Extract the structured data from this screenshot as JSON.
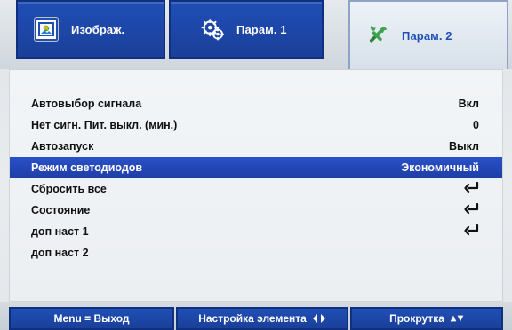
{
  "header": {
    "tabs": [
      {
        "label": "Изображ.",
        "icon": "picture-icon",
        "active": false
      },
      {
        "label": "Парам. 1",
        "icon": "gears-icon",
        "active": false
      },
      {
        "label": "Парам. 2",
        "icon": "tools-icon",
        "active": true
      }
    ]
  },
  "menu": {
    "items": [
      {
        "label": "Автовыбор сигнала",
        "value": "Вкл"
      },
      {
        "label": "Нет сигн. Пит. выкл. (мин.)",
        "value": "0"
      },
      {
        "label": "Автозапуск",
        "value": "Выкл"
      },
      {
        "label": "Режим светодиодов",
        "value": "Экономичный",
        "selected": true
      },
      {
        "label": "Сбросить все",
        "icon": "enter-icon"
      },
      {
        "label": "Состояние",
        "icon": "enter-icon"
      },
      {
        "label": "доп наст 1",
        "icon": "enter-icon"
      },
      {
        "label": "доп наст 2"
      }
    ]
  },
  "footer": {
    "help": [
      {
        "text": "Menu = Выход"
      },
      {
        "text": "Настройка элемента",
        "icon": "left-right-arrows-icon"
      },
      {
        "text": "Прокрутка",
        "icon": "up-down-arrows-icon"
      }
    ]
  },
  "colors": {
    "accent_blue": "#1f4fb6",
    "highlight_blue": "#1f3ea6"
  }
}
